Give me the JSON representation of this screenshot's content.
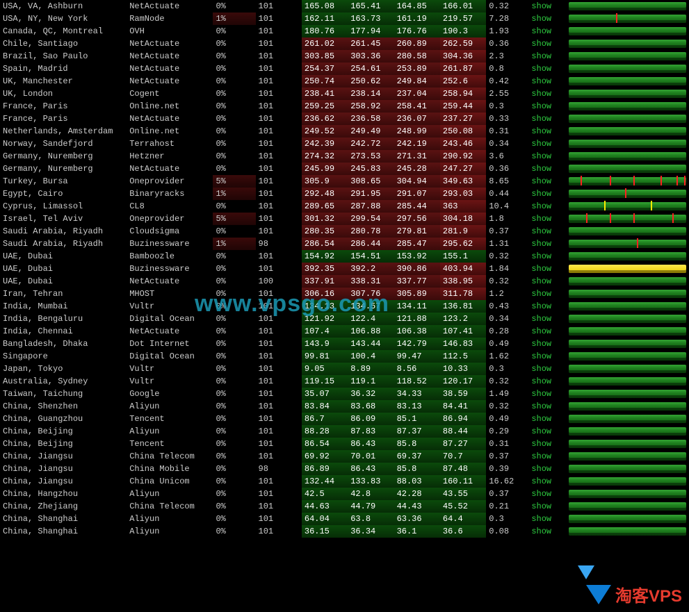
{
  "show_label": "show",
  "watermark": "www.vpsgo.com",
  "watermark2": "淘客VPS",
  "rows": [
    {
      "loc": "USA, VA, Ashburn",
      "prov": "NetActuate",
      "loss": "0%",
      "n": "101",
      "avg": "165.08",
      "last": "165.41",
      "best": "164.85",
      "worst": "166.01",
      "var": "0.32",
      "c": "g",
      "bar": "g"
    },
    {
      "loc": "USA, NY, New York",
      "prov": "RamNode",
      "loss": "1%",
      "n": "101",
      "avg": "162.11",
      "last": "163.73",
      "best": "161.19",
      "worst": "219.57",
      "var": "7.28",
      "c": "g",
      "bar": "g",
      "sp": [
        {
          "p": 40
        }
      ]
    },
    {
      "loc": "Canada, QC, Montreal",
      "prov": "OVH",
      "loss": "0%",
      "n": "101",
      "avg": "180.76",
      "last": "177.94",
      "best": "176.76",
      "worst": "190.3",
      "var": "1.93",
      "c": "g",
      "bar": "g"
    },
    {
      "loc": "Chile, Santiago",
      "prov": "NetActuate",
      "loss": "0%",
      "n": "101",
      "avg": "261.02",
      "last": "261.45",
      "best": "260.89",
      "worst": "262.59",
      "var": "0.36",
      "c": "r",
      "bar": "g"
    },
    {
      "loc": "Brazil, Sao Paulo",
      "prov": "NetActuate",
      "loss": "0%",
      "n": "101",
      "avg": "303.85",
      "last": "303.36",
      "best": "280.58",
      "worst": "304.36",
      "var": "2.3",
      "c": "r",
      "bar": "g"
    },
    {
      "loc": "Spain, Madrid",
      "prov": "NetActuate",
      "loss": "0%",
      "n": "101",
      "avg": "254.37",
      "last": "254.61",
      "best": "253.89",
      "worst": "261.87",
      "var": "0.8",
      "c": "r",
      "bar": "g"
    },
    {
      "loc": "UK, Manchester",
      "prov": "NetActuate",
      "loss": "0%",
      "n": "101",
      "avg": "250.74",
      "last": "250.62",
      "best": "249.84",
      "worst": "252.6",
      "var": "0.42",
      "c": "r",
      "bar": "g"
    },
    {
      "loc": "UK, London",
      "prov": "Cogent",
      "loss": "0%",
      "n": "101",
      "avg": "238.41",
      "last": "238.14",
      "best": "237.04",
      "worst": "258.94",
      "var": "2.55",
      "c": "r",
      "bar": "g"
    },
    {
      "loc": "France, Paris",
      "prov": "Online.net",
      "loss": "0%",
      "n": "101",
      "avg": "259.25",
      "last": "258.92",
      "best": "258.41",
      "worst": "259.44",
      "var": "0.3",
      "c": "r",
      "bar": "g"
    },
    {
      "loc": "France, Paris",
      "prov": "NetActuate",
      "loss": "0%",
      "n": "101",
      "avg": "236.62",
      "last": "236.58",
      "best": "236.07",
      "worst": "237.27",
      "var": "0.33",
      "c": "r",
      "bar": "g"
    },
    {
      "loc": "Netherlands, Amsterdam",
      "prov": "Online.net",
      "loss": "0%",
      "n": "101",
      "avg": "249.52",
      "last": "249.49",
      "best": "248.99",
      "worst": "250.08",
      "var": "0.31",
      "c": "r",
      "bar": "g"
    },
    {
      "loc": "Norway, Sandefjord",
      "prov": "Terrahost",
      "loss": "0%",
      "n": "101",
      "avg": "242.39",
      "last": "242.72",
      "best": "242.19",
      "worst": "243.46",
      "var": "0.34",
      "c": "r",
      "bar": "g"
    },
    {
      "loc": "Germany, Nuremberg",
      "prov": "Hetzner",
      "loss": "0%",
      "n": "101",
      "avg": "274.32",
      "last": "273.53",
      "best": "271.31",
      "worst": "290.92",
      "var": "3.6",
      "c": "r",
      "bar": "g"
    },
    {
      "loc": "Germany, Nuremberg",
      "prov": "NetActuate",
      "loss": "0%",
      "n": "101",
      "avg": "245.99",
      "last": "245.83",
      "best": "245.28",
      "worst": "247.27",
      "var": "0.36",
      "c": "r",
      "bar": "g"
    },
    {
      "loc": "Turkey, Bursa",
      "prov": "Oneprovider",
      "loss": "5%",
      "n": "101",
      "avg": "305.9",
      "last": "308.65",
      "best": "304.94",
      "worst": "349.63",
      "var": "8.65",
      "c": "r",
      "bar": "g",
      "sp": [
        {
          "p": 10
        },
        {
          "p": 35
        },
        {
          "p": 55
        },
        {
          "p": 78
        },
        {
          "p": 92
        },
        {
          "p": 98
        }
      ]
    },
    {
      "loc": "Egypt, Cairo",
      "prov": "Binaryracks",
      "loss": "1%",
      "n": "101",
      "avg": "292.48",
      "last": "291.95",
      "best": "291.07",
      "worst": "293.03",
      "var": "0.44",
      "c": "r",
      "bar": "g",
      "sp": [
        {
          "p": 48
        }
      ]
    },
    {
      "loc": "Cyprus, Limassol",
      "prov": "CL8",
      "loss": "0%",
      "n": "101",
      "avg": "289.65",
      "last": "287.88",
      "best": "285.44",
      "worst": "363",
      "var": "10.4",
      "c": "r",
      "bar": "g",
      "sp": [
        {
          "p": 30,
          "y": 1
        },
        {
          "p": 70,
          "y": 1
        }
      ]
    },
    {
      "loc": "Israel, Tel Aviv",
      "prov": "Oneprovider",
      "loss": "5%",
      "n": "101",
      "avg": "301.32",
      "last": "299.54",
      "best": "297.56",
      "worst": "304.18",
      "var": "1.8",
      "c": "r",
      "bar": "g",
      "sp": [
        {
          "p": 15
        },
        {
          "p": 35
        },
        {
          "p": 55
        },
        {
          "p": 88
        }
      ]
    },
    {
      "loc": "Saudi Arabia, Riyadh",
      "prov": "Cloudsigma",
      "loss": "0%",
      "n": "101",
      "avg": "280.35",
      "last": "280.78",
      "best": "279.81",
      "worst": "281.9",
      "var": "0.37",
      "c": "r",
      "bar": "g"
    },
    {
      "loc": "Saudi Arabia, Riyadh",
      "prov": "Buzinessware",
      "loss": "1%",
      "n": "98",
      "avg": "286.54",
      "last": "286.44",
      "best": "285.47",
      "worst": "295.62",
      "var": "1.31",
      "c": "r",
      "bar": "g",
      "sp": [
        {
          "p": 58
        }
      ]
    },
    {
      "loc": "UAE, Dubai",
      "prov": "Bamboozle",
      "loss": "0%",
      "n": "101",
      "avg": "154.92",
      "last": "154.51",
      "best": "153.92",
      "worst": "155.1",
      "var": "0.32",
      "c": "g",
      "bar": "g"
    },
    {
      "loc": "UAE, Dubai",
      "prov": "Buzinessware",
      "loss": "0%",
      "n": "101",
      "avg": "392.35",
      "last": "392.2",
      "best": "390.86",
      "worst": "403.94",
      "var": "1.84",
      "c": "r",
      "bar": "y"
    },
    {
      "loc": "UAE, Dubai",
      "prov": "NetActuate",
      "loss": "0%",
      "n": "100",
      "avg": "337.91",
      "last": "338.31",
      "best": "337.77",
      "worst": "338.95",
      "var": "0.32",
      "c": "r",
      "bar": "g"
    },
    {
      "loc": "Iran, Tehran",
      "prov": "MHOST",
      "loss": "0%",
      "n": "101",
      "avg": "306.16",
      "last": "307.76",
      "best": "305.89",
      "worst": "311.78",
      "var": "1.2",
      "c": "r",
      "bar": "g"
    },
    {
      "loc": "India, Mumbai",
      "prov": "Vultr",
      "loss": "0%",
      "n": "101",
      "avg": "134.13",
      "last": "134.57",
      "best": "134.11",
      "worst": "136.81",
      "var": "0.43",
      "c": "g",
      "bar": "g"
    },
    {
      "loc": "India, Bengaluru",
      "prov": "Digital Ocean",
      "loss": "0%",
      "n": "101",
      "avg": "121.92",
      "last": "122.4",
      "best": "121.88",
      "worst": "123.2",
      "var": "0.34",
      "c": "g",
      "bar": "g"
    },
    {
      "loc": "India, Chennai",
      "prov": "NetActuate",
      "loss": "0%",
      "n": "101",
      "avg": "107.4",
      "last": "106.88",
      "best": "106.38",
      "worst": "107.41",
      "var": "0.28",
      "c": "g",
      "bar": "g"
    },
    {
      "loc": "Bangladesh, Dhaka",
      "prov": "Dot Internet",
      "loss": "0%",
      "n": "101",
      "avg": "143.9",
      "last": "143.44",
      "best": "142.79",
      "worst": "146.83",
      "var": "0.49",
      "c": "g",
      "bar": "g"
    },
    {
      "loc": "Singapore",
      "prov": "Digital Ocean",
      "loss": "0%",
      "n": "101",
      "avg": "99.81",
      "last": "100.4",
      "best": "99.47",
      "worst": "112.5",
      "var": "1.62",
      "c": "g",
      "bar": "g"
    },
    {
      "loc": "Japan, Tokyo",
      "prov": "Vultr",
      "loss": "0%",
      "n": "101",
      "avg": "9.05",
      "last": "8.89",
      "best": "8.56",
      "worst": "10.33",
      "var": "0.3",
      "c": "g",
      "bar": "g"
    },
    {
      "loc": "Australia, Sydney",
      "prov": "Vultr",
      "loss": "0%",
      "n": "101",
      "avg": "119.15",
      "last": "119.1",
      "best": "118.52",
      "worst": "120.17",
      "var": "0.32",
      "c": "g",
      "bar": "g"
    },
    {
      "loc": "Taiwan, Taichung",
      "prov": "Google",
      "loss": "0%",
      "n": "101",
      "avg": "35.07",
      "last": "36.32",
      "best": "34.33",
      "worst": "38.59",
      "var": "1.49",
      "c": "g",
      "bar": "g"
    },
    {
      "loc": "China, Shenzhen",
      "prov": "Aliyun",
      "loss": "0%",
      "n": "101",
      "avg": "83.84",
      "last": "83.68",
      "best": "83.13",
      "worst": "84.41",
      "var": "0.32",
      "c": "g",
      "bar": "g"
    },
    {
      "loc": "China, Guangzhou",
      "prov": "Tencent",
      "loss": "0%",
      "n": "101",
      "avg": "86.7",
      "last": "86.09",
      "best": "85.1",
      "worst": "86.94",
      "var": "0.49",
      "c": "g",
      "bar": "g"
    },
    {
      "loc": "China, Beijing",
      "prov": "Aliyun",
      "loss": "0%",
      "n": "101",
      "avg": "88.28",
      "last": "87.83",
      "best": "87.37",
      "worst": "88.44",
      "var": "0.29",
      "c": "g",
      "bar": "g"
    },
    {
      "loc": "China, Beijing",
      "prov": "Tencent",
      "loss": "0%",
      "n": "101",
      "avg": "86.54",
      "last": "86.43",
      "best": "85.8",
      "worst": "87.27",
      "var": "0.31",
      "c": "g",
      "bar": "g"
    },
    {
      "loc": "China, Jiangsu",
      "prov": "China Telecom",
      "loss": "0%",
      "n": "101",
      "avg": "69.92",
      "last": "70.01",
      "best": "69.37",
      "worst": "70.7",
      "var": "0.37",
      "c": "g",
      "bar": "g"
    },
    {
      "loc": "China, Jiangsu",
      "prov": "China Mobile",
      "loss": "0%",
      "n": "98",
      "avg": "86.89",
      "last": "86.43",
      "best": "85.8",
      "worst": "87.48",
      "var": "0.39",
      "c": "g",
      "bar": "g"
    },
    {
      "loc": "China, Jiangsu",
      "prov": "China Unicom",
      "loss": "0%",
      "n": "101",
      "avg": "132.44",
      "last": "133.83",
      "best": "88.03",
      "worst": "160.11",
      "var": "16.62",
      "c": "g",
      "bar": "g"
    },
    {
      "loc": "China, Hangzhou",
      "prov": "Aliyun",
      "loss": "0%",
      "n": "101",
      "avg": "42.5",
      "last": "42.8",
      "best": "42.28",
      "worst": "43.55",
      "var": "0.37",
      "c": "g",
      "bar": "g"
    },
    {
      "loc": "China, Zhejiang",
      "prov": "China Telecom",
      "loss": "0%",
      "n": "101",
      "avg": "44.63",
      "last": "44.79",
      "best": "44.43",
      "worst": "45.52",
      "var": "0.21",
      "c": "g",
      "bar": "g"
    },
    {
      "loc": "China, Shanghai",
      "prov": "Aliyun",
      "loss": "0%",
      "n": "101",
      "avg": "64.04",
      "last": "63.8",
      "best": "63.36",
      "worst": "64.4",
      "var": "0.3",
      "c": "g",
      "bar": "g"
    },
    {
      "loc": "China, Shanghai",
      "prov": "Aliyun",
      "loss": "0%",
      "n": "101",
      "avg": "36.15",
      "last": "36.34",
      "best": "36.1",
      "worst": "36.6",
      "var": "0.08",
      "c": "g",
      "bar": "g"
    }
  ]
}
